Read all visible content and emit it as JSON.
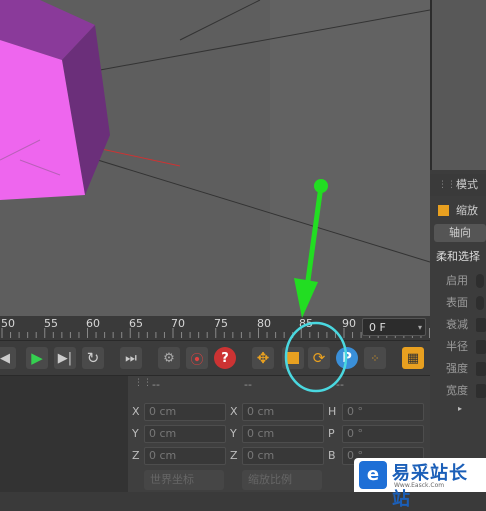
{
  "viewport": {
    "description_hidden": ""
  },
  "timeline": {
    "ticks": [
      "50",
      "55",
      "60",
      "65",
      "70",
      "75",
      "80",
      "85",
      "90"
    ],
    "current_frame": "0 F"
  },
  "right_panel": {
    "mode_label": "模式",
    "scale_label": "缩放",
    "axis_button": "轴向",
    "soft_select_label": "柔和选择",
    "props": [
      "启用",
      "表面",
      "衰减",
      "半径",
      "强度",
      "宽度"
    ]
  },
  "coords": {
    "header_dashes": [
      "--",
      "--",
      "--"
    ],
    "rows": [
      {
        "a1": "X",
        "v1": "0 cm",
        "a2": "X",
        "v2": "0 cm",
        "a3": "H",
        "v3": "0 °"
      },
      {
        "a1": "Y",
        "v1": "0 cm",
        "a2": "Y",
        "v2": "0 cm",
        "a3": "P",
        "v3": "0 °"
      },
      {
        "a1": "Z",
        "v1": "0 cm",
        "a2": "Z",
        "v2": "0 cm",
        "a3": "B",
        "v3": "0 °"
      }
    ],
    "dropdown_world": "世界坐标",
    "dropdown_scale": "缩放比例"
  },
  "watermark": {
    "logo_char": "e",
    "name": "易采站长站",
    "url": "Www.Easck.Com"
  },
  "colors": {
    "annotation": "#22dd22",
    "highlight_circle": "#4ad8e0",
    "cube": "#d04fd8"
  }
}
